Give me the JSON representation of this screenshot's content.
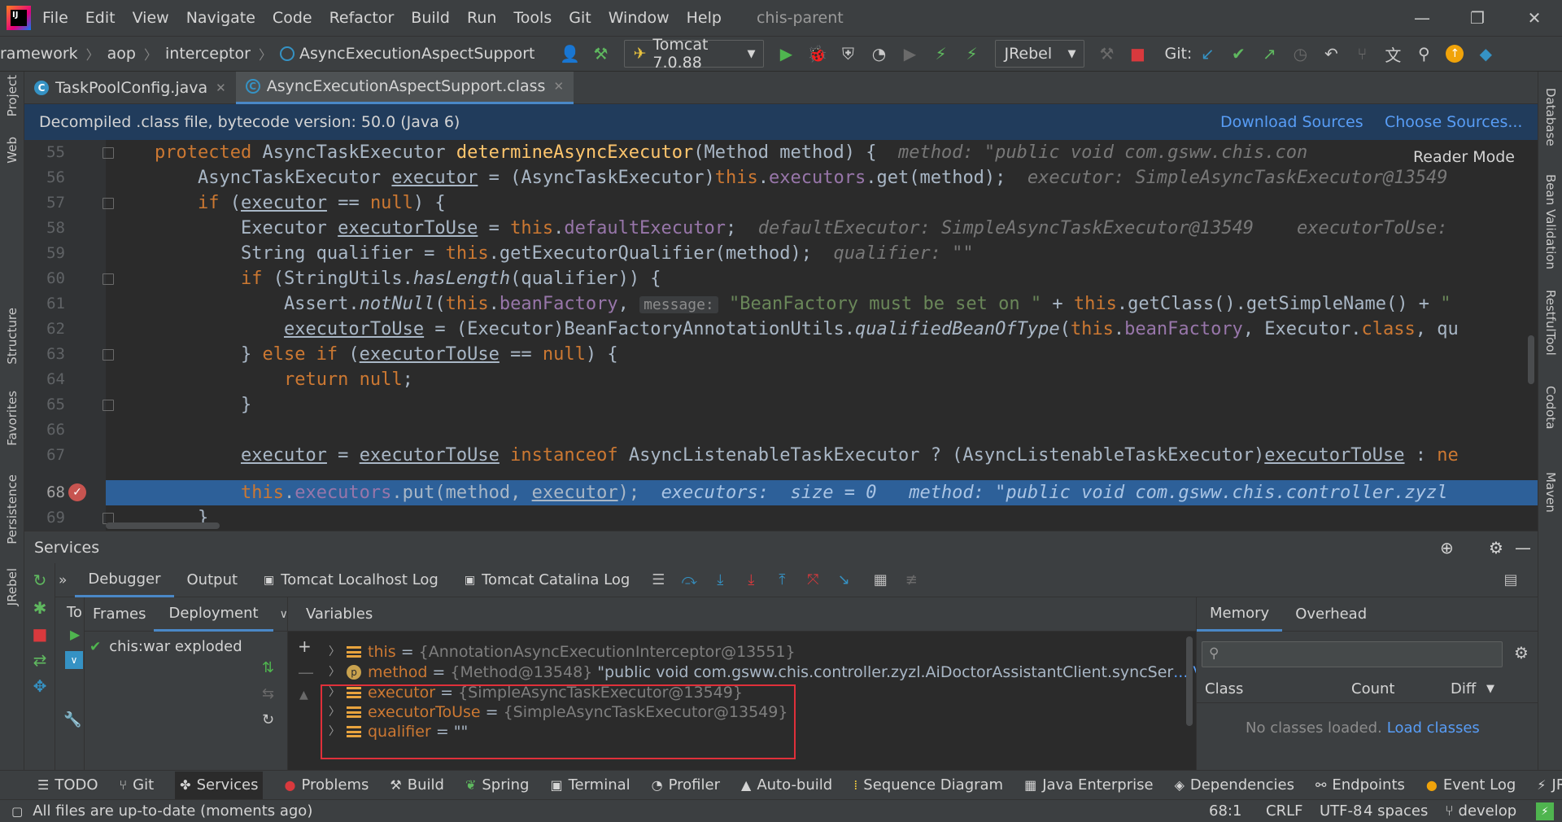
{
  "window": {
    "menu": [
      "File",
      "Edit",
      "View",
      "Navigate",
      "Code",
      "Refactor",
      "Build",
      "Run",
      "Tools",
      "Git",
      "Window",
      "Help"
    ],
    "project": "chis-parent"
  },
  "nav": {
    "breadcrumbs": [
      "ramework",
      "aop",
      "interceptor",
      "AsyncExecutionAspectSupport"
    ],
    "run_config": "Tomcat 7.0.88",
    "jrebel": "JRebel",
    "git_label": "Git:"
  },
  "tabs": [
    {
      "label": "TaskPoolConfig.java"
    },
    {
      "label": "AsyncExecutionAspectSupport.class"
    }
  ],
  "banner": {
    "text": "Decompiled .class file, bytecode version: 50.0 (Java 6)",
    "download": "Download Sources",
    "choose": "Choose Sources..."
  },
  "editor": {
    "reader_mode": "Reader Mode",
    "line_numbers": [
      "55",
      "56",
      "57",
      "58",
      "59",
      "60",
      "61",
      "62",
      "63",
      "64",
      "65",
      "66",
      "67",
      "68",
      "69"
    ],
    "current_line": "68"
  },
  "side_tools": {
    "left": [
      "Project",
      "Web",
      "Structure",
      "Favorites",
      "Persistence",
      "JRebel"
    ],
    "right": [
      "Database",
      "Bean Validation",
      "RestfulTool",
      "Codota",
      "Maven"
    ]
  },
  "services": {
    "title": "Services",
    "debugger_tabs": [
      "Debugger",
      "Output",
      "Tomcat Localhost Log",
      "Tomcat Catalina Log"
    ],
    "frames_tabs": [
      "Frames",
      "Deployment"
    ],
    "deployment_item": "chis:war exploded",
    "tree_stub": "To",
    "variables_title": "Variables",
    "variables": [
      {
        "name": "this",
        "value": "{AnnotationAsyncExecutionInterceptor@13551}",
        "extra": ""
      },
      {
        "name": "method",
        "value": "{Method@13548}",
        "extra": "\"public void com.gsww.chis.controller.zyzl.AiDoctorAssistantClient.syncSer",
        "view": "... View"
      },
      {
        "name": "executor",
        "value": "{SimpleAsyncTaskExecutor@13549}",
        "extra": ""
      },
      {
        "name": "executorToUse",
        "value": "{SimpleAsyncTaskExecutor@13549}",
        "extra": ""
      },
      {
        "name": "qualifier",
        "value": "\"\"",
        "extra": ""
      }
    ],
    "memory_tabs": [
      "Memory",
      "Overhead"
    ],
    "memory_cols": [
      "Class",
      "Count",
      "Diff"
    ],
    "no_classes": "No classes loaded.",
    "load_classes": "Load classes"
  },
  "bottom_tools": [
    "TODO",
    "Git",
    "Services",
    "Problems",
    "Build",
    "Spring",
    "Terminal",
    "Profiler",
    "Auto-build",
    "Sequence Diagram",
    "Java Enterprise",
    "Dependencies",
    "Endpoints",
    "Event Log",
    "JRebe"
  ],
  "status": {
    "message": "All files are up-to-date (moments ago)",
    "position": "68:1",
    "line_sep": "CRLF",
    "encoding": "UTF-8",
    "indent": "4 spaces",
    "branch": "develop"
  },
  "colors": {
    "accent": "#4a88c7",
    "highlight": "#2d6099",
    "error": "#e0303a",
    "link": "#589df6"
  }
}
